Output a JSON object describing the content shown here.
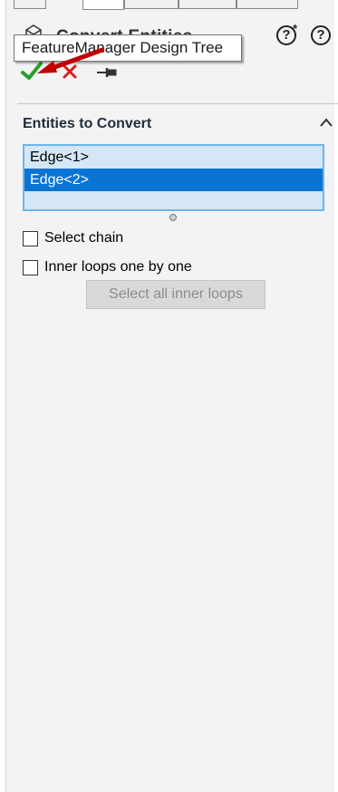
{
  "header": {
    "title": "Convert Entities",
    "whats_new_label": "?",
    "whats_new_star": "*",
    "help_label": "?"
  },
  "tooltip": {
    "text": "FeatureManager Design Tree"
  },
  "section": {
    "title": "Entities to Convert"
  },
  "list": {
    "items": [
      "Edge<1>",
      "Edge<2>"
    ],
    "selected_index": 1
  },
  "options": {
    "select_chain": {
      "label": "Select chain",
      "checked": false
    },
    "inner_loops": {
      "label": "Inner loops one by one",
      "checked": false
    },
    "select_all_inner_loops_label": "Select all inner loops"
  },
  "colors": {
    "ok_green": "#2a9d2a",
    "cancel_red": "#d42020",
    "arrow_red": "#c00000",
    "selection_blue": "#0a74d5"
  }
}
